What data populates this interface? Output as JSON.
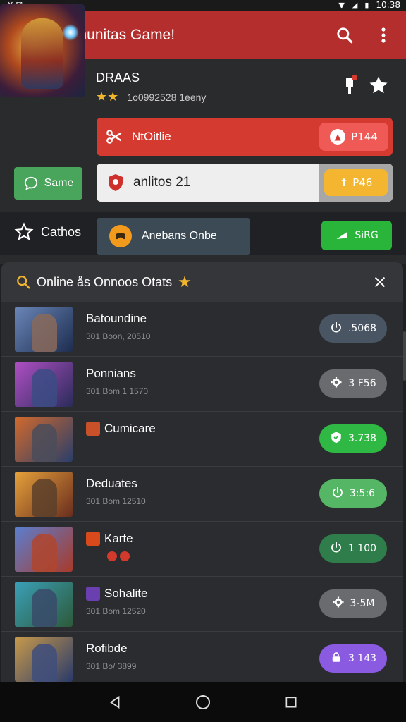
{
  "status_bar": {
    "left": "✕ ✉",
    "time": "10:38"
  },
  "app_bar": {
    "title": "Komunitas Game!"
  },
  "featured": {
    "name": "DRAAS",
    "stars": "★★",
    "meta": "1o0992528 1eeny",
    "primary_button": {
      "label": "NtOitlie",
      "pill": "P144"
    },
    "secondary_button": {
      "label": "anlitos 21",
      "pill": "P46"
    },
    "side_button": {
      "label": "Same"
    },
    "category": {
      "label": "Cathos"
    },
    "dark_button": {
      "label": "Anebans Onbe"
    },
    "green_button": {
      "label": "SiRG"
    }
  },
  "panel": {
    "title": "Online ås Onnoos Otats",
    "items": [
      {
        "name": "Batoundine",
        "sub": "301 Boon, 20510",
        "value": ".5068",
        "btn_color": "#4a5563",
        "icon": "power-icon",
        "thumb": [
          "#6a86b8",
          "#1d2d4f"
        ],
        "fig": "#8a6a5a"
      },
      {
        "name": "Ponnians",
        "sub": "301 Bom 1 1570",
        "value": "3 F56",
        "btn_color": "#6a6b6e",
        "icon": "gear-icon",
        "thumb": [
          "#b04fc4",
          "#2a2c5a"
        ],
        "fig": "#3b4c84"
      },
      {
        "name": "Cumicare",
        "sub": "",
        "value": "3.738",
        "btn_color": "#2fb843",
        "icon": "shield-icon",
        "thumb": [
          "#d26a2c",
          "#2a3e6a"
        ],
        "fig": "#4a4c5a",
        "tag": "#c8512a"
      },
      {
        "name": "Deduates",
        "sub": "301 Bom 12510",
        "value": "3:5:6",
        "btn_color": "#55b665",
        "icon": "power-icon",
        "thumb": [
          "#e6a23a",
          "#6a2d1e"
        ],
        "fig": "#5a3f2a"
      },
      {
        "name": "Karte",
        "sub": "",
        "value": "1 100",
        "btn_color": "#2e7d4a",
        "icon": "power-icon",
        "thumb": [
          "#5a7fd0",
          "#a83a2a"
        ],
        "fig": "#b0452e",
        "tag": "#d84a1c",
        "badges": 2
      },
      {
        "name": "Sohalite",
        "sub": "301 Bom 12520",
        "value": "3-5M",
        "btn_color": "#6a6b6e",
        "icon": "gear-icon",
        "thumb": [
          "#3aa0b8",
          "#2d5a3a"
        ],
        "fig": "#3a4a6a",
        "tag": "#6a3fb0"
      },
      {
        "name": "Rofibde",
        "sub": "301 Bo/ 3899",
        "value": "3 143",
        "btn_color": "#8a5ae0",
        "icon": "lock-icon",
        "thumb": [
          "#c89a4a",
          "#2a3a6a"
        ],
        "fig": "#3e4d7c"
      }
    ]
  },
  "colors": {
    "app_bar": "#b32e2c",
    "primary": "#d53a30",
    "accent_yellow": "#f4b630",
    "accent_green": "#28b53a"
  }
}
